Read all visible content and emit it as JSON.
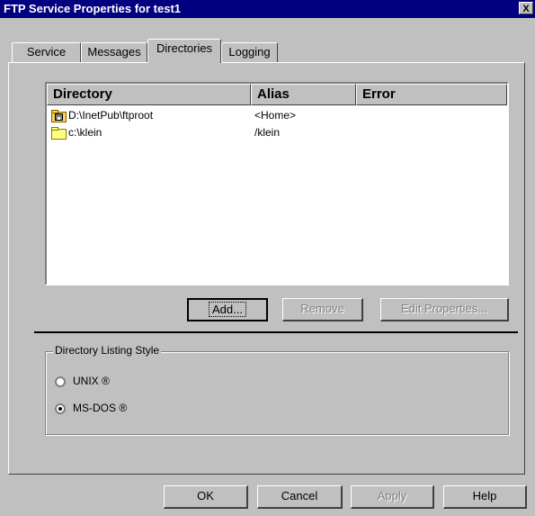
{
  "window": {
    "title": "FTP Service Properties for test1",
    "close_glyph": "X"
  },
  "tabs": [
    {
      "label": "Service",
      "active": false
    },
    {
      "label": "Messages",
      "active": false
    },
    {
      "label": "Directories",
      "active": true
    },
    {
      "label": "Logging",
      "active": false
    }
  ],
  "directories": {
    "columns": [
      "Directory",
      "Alias",
      "Error"
    ],
    "rows": [
      {
        "directory": "D:\\InetPub\\ftproot",
        "alias": "<Home>",
        "error": "",
        "icon": "home-directory-icon"
      },
      {
        "directory": "c:\\klein",
        "alias": "/klein",
        "error": "",
        "icon": "folder-icon"
      }
    ],
    "buttons": {
      "add": "Add...",
      "remove": "Remove",
      "edit_properties": "Edit Properties..."
    }
  },
  "listing_style": {
    "group_label": "Directory Listing Style",
    "options": [
      {
        "label": "UNIX ®",
        "selected": false
      },
      {
        "label": "MS-DOS ®",
        "selected": true
      }
    ]
  },
  "footer_buttons": {
    "ok": "OK",
    "cancel": "Cancel",
    "apply": "Apply",
    "help": "Help"
  }
}
